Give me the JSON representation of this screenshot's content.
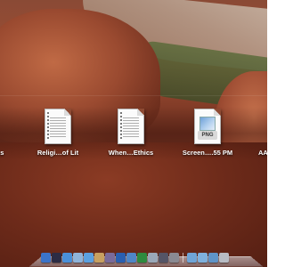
{
  "desktop": {
    "icons": [
      {
        "label": "us",
        "kind": "text-document-icon"
      },
      {
        "label": "Religi…of Lit",
        "kind": "text-document-icon"
      },
      {
        "label": "When…Ethics",
        "kind": "text-document-icon"
      },
      {
        "label": "Screen….55 PM",
        "kind": "png-file-icon",
        "badge": "PNG"
      },
      {
        "label": "AA",
        "kind": "text-document-icon"
      }
    ]
  },
  "dock": {
    "items": [
      {
        "name": "finder-icon",
        "color": "#3b74c9"
      },
      {
        "name": "dashboard-icon",
        "color": "#2c2c44"
      },
      {
        "name": "safari-icon",
        "color": "#4a90d9"
      },
      {
        "name": "mail-icon",
        "color": "#8fb3d9"
      },
      {
        "name": "ichat-icon",
        "color": "#5ba0e0"
      },
      {
        "name": "address-book-icon",
        "color": "#c8a060"
      },
      {
        "name": "photo-icon",
        "color": "#7a6a9a"
      },
      {
        "name": "word-icon",
        "color": "#2a5fb0"
      },
      {
        "name": "itunes-icon",
        "color": "#4f86c6"
      },
      {
        "name": "excel-icon",
        "color": "#2e8b3e"
      },
      {
        "name": "preview-icon",
        "color": "#9aa8b8"
      },
      {
        "name": "activity-icon",
        "color": "#556"
      },
      {
        "name": "system-preferences-icon",
        "color": "#8a8a92"
      },
      {
        "name": "applications-folder-icon",
        "color": "#6fa4d6"
      },
      {
        "name": "documents-folder-icon",
        "color": "#7fb0dc"
      },
      {
        "name": "downloads-folder-icon",
        "color": "#5f94c8"
      },
      {
        "name": "trash-icon",
        "color": "#b8bcc4"
      }
    ]
  }
}
